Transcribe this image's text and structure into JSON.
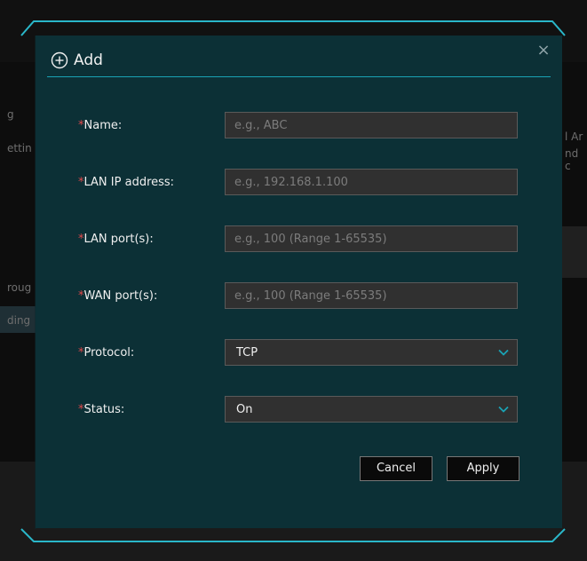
{
  "background": {
    "items": [
      "g",
      "ettin",
      "roug",
      "ding",
      "l Ar",
      "nd c"
    ]
  },
  "dialog": {
    "title": "Add",
    "close_label": "×",
    "fields": [
      {
        "label": "Name:",
        "placeholder": "e.g., ABC"
      },
      {
        "label": "LAN IP address:",
        "placeholder": "e.g., 192.168.1.100"
      },
      {
        "label": "LAN port(s):",
        "placeholder": "e.g., 100 (Range 1-65535)"
      },
      {
        "label": "WAN port(s):",
        "placeholder": "e.g., 100 (Range 1-65535)"
      }
    ],
    "protocol": {
      "label": "Protocol:",
      "value": "TCP"
    },
    "status": {
      "label": "Status:",
      "value": "On"
    },
    "required_mark": "*",
    "cancel_label": "Cancel",
    "apply_label": "Apply"
  },
  "colors": {
    "accent": "#1aa3b5",
    "dialog_bg": "#0c3036",
    "required": "#e2484a"
  },
  "icons": [
    "plus-circle-icon",
    "close-icon",
    "chevron-down-icon"
  ]
}
